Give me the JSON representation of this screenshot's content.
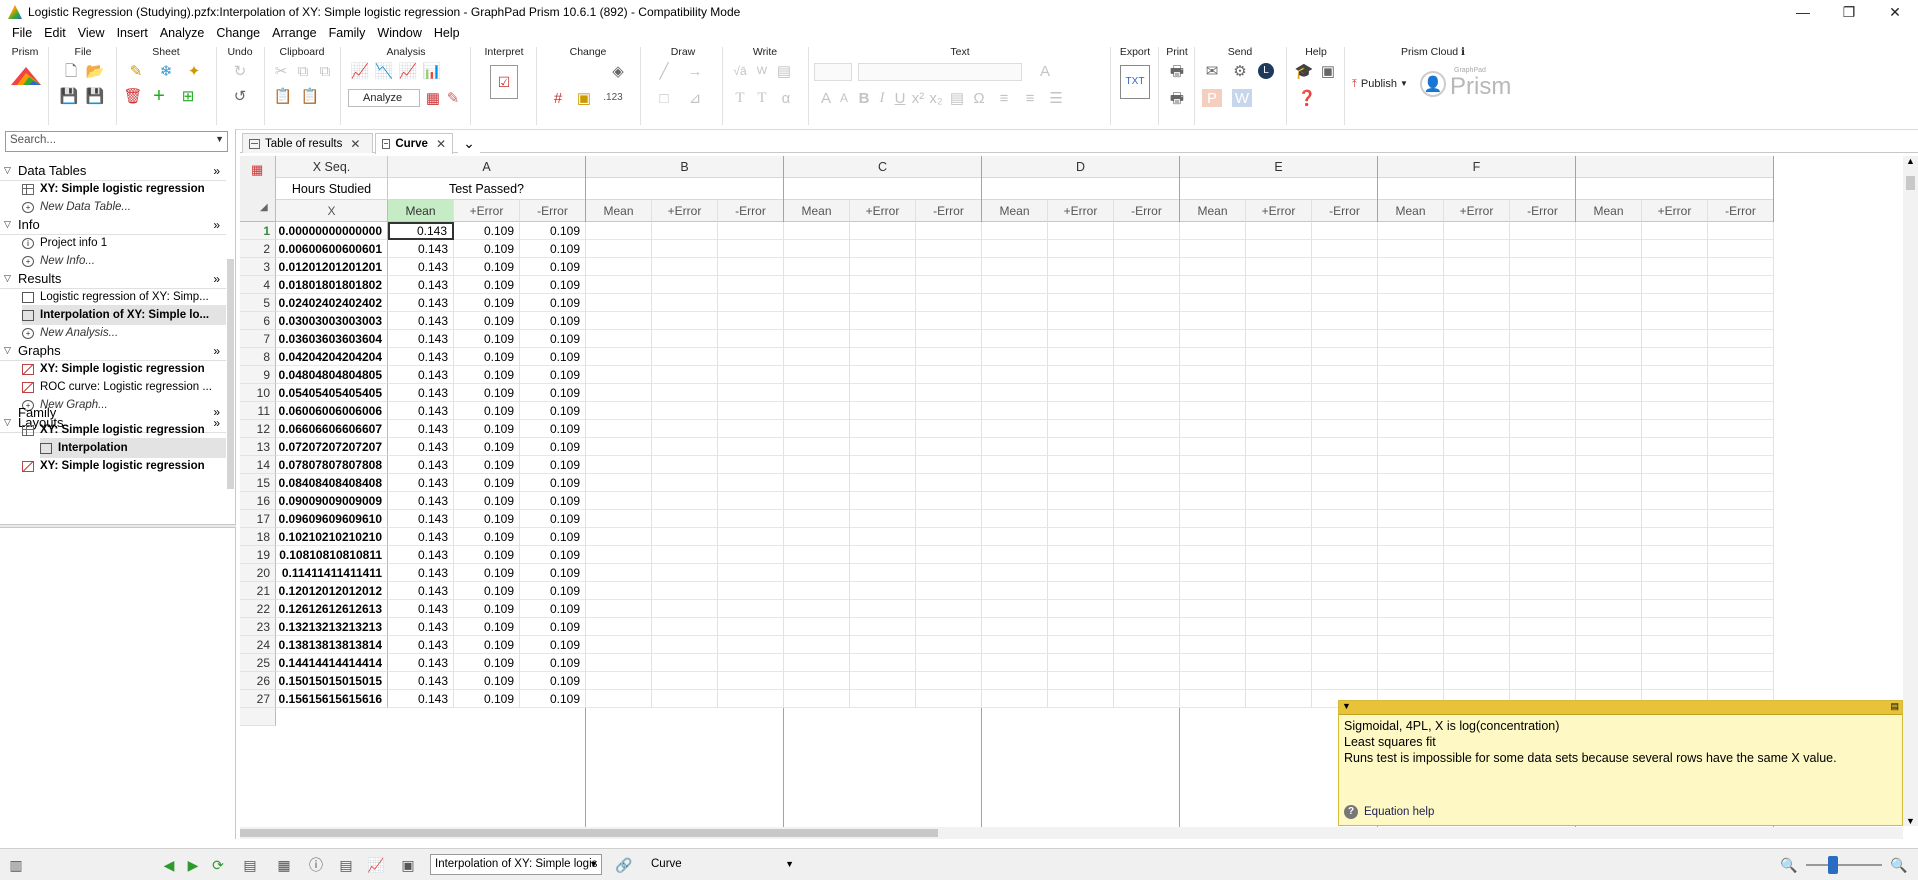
{
  "window": {
    "title": "Logistic Regression (Studying).pzfx:Interpolation of XY: Simple logistic regression - GraphPad Prism 10.6.1 (892) - Compatibility Mode",
    "min_glyph": "—",
    "max_glyph": "❐",
    "close_glyph": "✕"
  },
  "menu": [
    "File",
    "Edit",
    "View",
    "Insert",
    "Analyze",
    "Change",
    "Arrange",
    "Family",
    "Window",
    "Help"
  ],
  "ribbon": {
    "groups": [
      "Prism",
      "File",
      "Sheet",
      "Undo",
      "Clipboard",
      "Analysis",
      "Interpret",
      "Change",
      "Draw",
      "Write",
      "Text",
      "Export",
      "Print",
      "Send",
      "Help",
      "Prism Cloud"
    ],
    "analyze_label": "Analyze",
    "publish_label": "Publish",
    "brand_small": "GraphPad",
    "brand": "Prism",
    "info_glyph": "ℹ"
  },
  "tabs": [
    {
      "label": "Table of results",
      "close": "✕"
    },
    {
      "label": "Curve",
      "close": "✕"
    }
  ],
  "tab_menu_glyph": "⌄",
  "search": {
    "placeholder": "Search..."
  },
  "nav": {
    "sections": [
      {
        "title": "Data Tables",
        "items": [
          {
            "label": "XY: Simple logistic regression",
            "icon": "grid"
          },
          {
            "label": "New Data Table...",
            "icon": "plus"
          }
        ]
      },
      {
        "title": "Info",
        "items": [
          {
            "label": "Project info 1",
            "icon": "info"
          },
          {
            "label": "New Info...",
            "icon": "plus"
          }
        ]
      },
      {
        "title": "Results",
        "items": [
          {
            "label": "Logistic regression of XY: Simp...",
            "icon": "doc"
          },
          {
            "label": "Interpolation of XY: Simple lo...",
            "icon": "doc"
          },
          {
            "label": "New Analysis...",
            "icon": "plus"
          }
        ]
      },
      {
        "title": "Graphs",
        "items": [
          {
            "label": "XY: Simple logistic regression",
            "icon": "graph"
          },
          {
            "label": "ROC curve: Logistic regression ...",
            "icon": "graph"
          },
          {
            "label": "New Graph...",
            "icon": "plus"
          }
        ]
      },
      {
        "title": "Layouts",
        "items": []
      }
    ],
    "family": {
      "title": "Family",
      "items": [
        {
          "label": "XY: Simple logistic regression",
          "icon": "grid"
        },
        {
          "label": "Interpolation",
          "icon": "doc"
        },
        {
          "label": "XY: Simple logistic regression",
          "icon": "graph"
        }
      ]
    },
    "expand_glyph": "»"
  },
  "grid": {
    "x_col_title": "X Seq.",
    "x_col_name": "Hours Studied",
    "x_sub": "X",
    "col_letters": [
      "A",
      "B",
      "C",
      "D",
      "E",
      "F"
    ],
    "col_A_name": "Test Passed?",
    "sub_headers": [
      "Mean",
      "+Error",
      "-Error"
    ],
    "rows": [
      {
        "n": "1",
        "x": "0.00000000000000",
        "v": [
          "0.143",
          "0.109",
          "0.109"
        ]
      },
      {
        "n": "2",
        "x": "0.00600600600601",
        "v": [
          "0.143",
          "0.109",
          "0.109"
        ]
      },
      {
        "n": "3",
        "x": "0.01201201201201",
        "v": [
          "0.143",
          "0.109",
          "0.109"
        ]
      },
      {
        "n": "4",
        "x": "0.01801801801802",
        "v": [
          "0.143",
          "0.109",
          "0.109"
        ]
      },
      {
        "n": "5",
        "x": "0.02402402402402",
        "v": [
          "0.143",
          "0.109",
          "0.109"
        ]
      },
      {
        "n": "6",
        "x": "0.03003003003003",
        "v": [
          "0.143",
          "0.109",
          "0.109"
        ]
      },
      {
        "n": "7",
        "x": "0.03603603603604",
        "v": [
          "0.143",
          "0.109",
          "0.109"
        ]
      },
      {
        "n": "8",
        "x": "0.04204204204204",
        "v": [
          "0.143",
          "0.109",
          "0.109"
        ]
      },
      {
        "n": "9",
        "x": "0.04804804804805",
        "v": [
          "0.143",
          "0.109",
          "0.109"
        ]
      },
      {
        "n": "10",
        "x": "0.05405405405405",
        "v": [
          "0.143",
          "0.109",
          "0.109"
        ]
      },
      {
        "n": "11",
        "x": "0.06006006006006",
        "v": [
          "0.143",
          "0.109",
          "0.109"
        ]
      },
      {
        "n": "12",
        "x": "0.06606606606607",
        "v": [
          "0.143",
          "0.109",
          "0.109"
        ]
      },
      {
        "n": "13",
        "x": "0.07207207207207",
        "v": [
          "0.143",
          "0.109",
          "0.109"
        ]
      },
      {
        "n": "14",
        "x": "0.07807807807808",
        "v": [
          "0.143",
          "0.109",
          "0.109"
        ]
      },
      {
        "n": "15",
        "x": "0.08408408408408",
        "v": [
          "0.143",
          "0.109",
          "0.109"
        ]
      },
      {
        "n": "16",
        "x": "0.09009009009009",
        "v": [
          "0.143",
          "0.109",
          "0.109"
        ]
      },
      {
        "n": "17",
        "x": "0.09609609609610",
        "v": [
          "0.143",
          "0.109",
          "0.109"
        ]
      },
      {
        "n": "18",
        "x": "0.10210210210210",
        "v": [
          "0.143",
          "0.109",
          "0.109"
        ]
      },
      {
        "n": "19",
        "x": "0.10810810810811",
        "v": [
          "0.143",
          "0.109",
          "0.109"
        ]
      },
      {
        "n": "20",
        "x": "0.11411411411411",
        "v": [
          "0.143",
          "0.109",
          "0.109"
        ]
      },
      {
        "n": "21",
        "x": "0.12012012012012",
        "v": [
          "0.143",
          "0.109",
          "0.109"
        ]
      },
      {
        "n": "22",
        "x": "0.12612612612613",
        "v": [
          "0.143",
          "0.109",
          "0.109"
        ]
      },
      {
        "n": "23",
        "x": "0.13213213213213",
        "v": [
          "0.143",
          "0.109",
          "0.109"
        ]
      },
      {
        "n": "24",
        "x": "0.13813813813814",
        "v": [
          "0.143",
          "0.109",
          "0.109"
        ]
      },
      {
        "n": "25",
        "x": "0.14414414414414",
        "v": [
          "0.143",
          "0.109",
          "0.109"
        ]
      },
      {
        "n": "26",
        "x": "0.15015015015015",
        "v": [
          "0.143",
          "0.109",
          "0.109"
        ]
      },
      {
        "n": "27",
        "x": "0.15615615615616",
        "v": [
          "0.143",
          "0.109",
          "0.109"
        ]
      }
    ]
  },
  "info_panel": {
    "lines": [
      "Sigmoidal, 4PL, X is log(concentration)",
      "Least squares fit",
      "Runs test is impossible for some data sets because several rows have the same X value."
    ],
    "link": "Equation help",
    "help_glyph": "?"
  },
  "statusbar": {
    "sheet_combo": "Interpolation of XY: Simple logis",
    "view_combo": "Curve",
    "zoom_out": "🔍",
    "zoom_in": "🔍",
    "back_glyph": "◀",
    "forward_glyph": "▶"
  },
  "colors": {
    "mean_highlight": "#c5ecc5",
    "dataset_divider": "#7cc07c",
    "info_panel_bg": "#fdf8c4",
    "info_panel_header": "#e8c33a"
  }
}
